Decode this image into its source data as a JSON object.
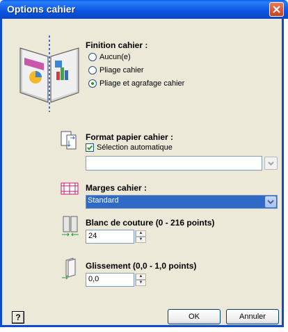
{
  "window": {
    "title": "Options cahier"
  },
  "finition": {
    "label": "Finition cahier :",
    "options": [
      {
        "label": "Aucun(e)",
        "selected": false
      },
      {
        "label": "Pliage cahier",
        "selected": false
      },
      {
        "label": "Pliage et agrafage cahier",
        "selected": true
      }
    ]
  },
  "format": {
    "label": "Format papier cahier :",
    "auto_label": "Sélection automatique",
    "auto_checked": true,
    "value": ""
  },
  "marges": {
    "label": "Marges cahier :",
    "value": "Standard"
  },
  "blanc": {
    "label": "Blanc de couture (0 - 216 points)",
    "value": "24"
  },
  "glissement": {
    "label": "Glissement (0,0 - 1,0 points)",
    "value": "0,0"
  },
  "buttons": {
    "ok": "OK",
    "cancel": "Annuler",
    "help": "?"
  },
  "colors": {
    "titlebar": "#0a55e0",
    "selection": "#316ac5",
    "dialog_bg": "#ece9d8"
  },
  "icons": [
    "close-icon",
    "booklet-icon",
    "paper-format-icon",
    "margins-icon",
    "gutter-icon",
    "creep-icon",
    "help-icon"
  ]
}
